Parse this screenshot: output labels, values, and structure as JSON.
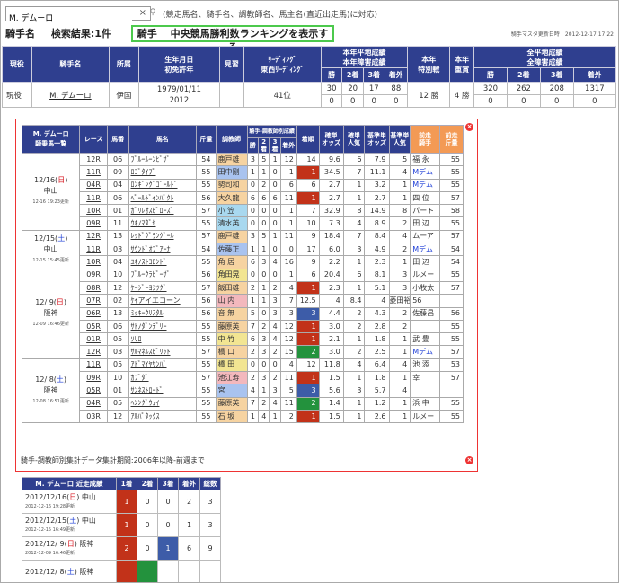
{
  "search": {
    "value": "M. デムーロ",
    "hint": "(競走馬名、騎手名、調教師名、馬主名(直近出走馬)に対応)"
  },
  "header": {
    "label": "騎手名",
    "result": "検索結果:1件",
    "ranking_button": "騎手　 中央競馬勝利数ランキングを表示する",
    "mask_date": "騎手マスタ更新日時　2012-12-17 17:22"
  },
  "main": {
    "headers": {
      "status": "現役",
      "name": "騎手名",
      "affiliation": "所属",
      "birth1": "生年月日",
      "birth2": "初免許年",
      "apprentice": "見習",
      "leading1": "ﾘｰﾃﾞｨﾝｸﾞ",
      "leading2": "東西ﾘｰﾃﾞｨﾝｸﾞ",
      "flat1": "本年平地成績",
      "flat2": "本年障害成績",
      "special1": "本年",
      "special2": "特別戦",
      "graded1": "本年",
      "graded2": "重賞",
      "total1": "全平地成績",
      "total2": "全障害成績",
      "win": "勝",
      "second": "2着",
      "third": "3着",
      "other": "着外"
    },
    "row": {
      "status": "現役",
      "name": "M. デムーロ",
      "affiliation": "伊国",
      "birth": "1979/01/11",
      "license": "2012",
      "apprentice": "",
      "leading": "41位",
      "flat": [
        "30",
        "20",
        "17",
        "88"
      ],
      "hurdle": [
        "0",
        "0",
        "0",
        "0"
      ],
      "special": "12 勝",
      "graded": "4 勝",
      "total_flat": [
        "320",
        "262",
        "208",
        "1317"
      ],
      "total_hurdle": [
        "0",
        "0",
        "0",
        "0"
      ]
    }
  },
  "popup": {
    "title1": "M. デムーロ",
    "title2": "騎乗馬一覧",
    "headers": {
      "race": "レース",
      "num": "馬番",
      "horse": "馬名",
      "weight": "斤量",
      "trainer": "調教師",
      "tstats": "騎手-調教師別成績",
      "w": "勝",
      "s2": "2着",
      "s3": "3着",
      "out": "着外",
      "finish": "着順",
      "odds": "確単\nオッズ",
      "pop": "確単\n人気",
      "bodds": "基準単\nオッズ",
      "bpop": "基準単\n人気",
      "prev_jockey": "前走\n騎手",
      "prev_weight": "前走\n斤量"
    },
    "dates": [
      {
        "d": "12/16(",
        "dw": "日",
        "e": ")",
        "venue": "中山",
        "upd": "12-16 19:23更新",
        "dcol": "red"
      },
      {
        "d": "12/15(",
        "dw": "土",
        "e": ")",
        "venue": "中山",
        "upd": "12-15 15:45更新",
        "dcol": "blue"
      },
      {
        "d": "12/ 9(",
        "dw": "日",
        "e": ")",
        "venue": "阪神",
        "upd": "12-09 16:46更新",
        "dcol": "red"
      },
      {
        "d": "12/ 8(",
        "dw": "土",
        "e": ")",
        "venue": "阪神",
        "upd": "12-08 16:51更新",
        "dcol": "blue"
      }
    ],
    "rows": [
      [
        "12R",
        "06",
        "ﾌﾞﾙｰﾙｰﾝﾋﾞｻﾞ",
        "54",
        "鹿戸雄",
        "3",
        "5",
        "1",
        "12",
        "14",
        "9.6",
        "6",
        "7.9",
        "5",
        "福 永",
        "55"
      ],
      [
        "11R",
        "09",
        "ﾛｺﾞﾀｲﾌﾟ",
        "55",
        "田中剛",
        "1",
        "1",
        "0",
        "1",
        "1",
        "34.5",
        "7",
        "11.1",
        "4",
        "Mデム",
        "55"
      ],
      [
        "04R",
        "04",
        "ﾛﾝｷﾞﾝｸﾞｺﾞｰﾙﾄﾞ",
        "55",
        "勢司和",
        "0",
        "2",
        "0",
        "6",
        "6",
        "2.7",
        "1",
        "3.2",
        "1",
        "Mデム",
        "55"
      ],
      [
        "11R",
        "06",
        "ﾍﾟｰﾙﾄﾞｲﾝﾊﾟｸﾄ",
        "56",
        "大久龍",
        "6",
        "6",
        "6",
        "11",
        "1",
        "2.7",
        "1",
        "2.7",
        "1",
        "四 位",
        "57"
      ],
      [
        "10R",
        "01",
        "ｶﾞﾘﾚｵｽﾋﾟﾛｰｽﾞ",
        "57",
        "小 笠",
        "0",
        "0",
        "0",
        "1",
        "7",
        "32.9",
        "8",
        "14.9",
        "8",
        "パート",
        "58"
      ],
      [
        "09R",
        "11",
        "ｳｷﾉﾏﾀﾞｾ",
        "55",
        "清水英",
        "0",
        "0",
        "0",
        "1",
        "10",
        "7.3",
        "4",
        "8.9",
        "2",
        "田 辺",
        "55"
      ],
      [
        "12R",
        "13",
        "ﾚｯﾄﾞｸﾞﾗﾝｸﾞｰﾙ",
        "57",
        "鹿戸雄",
        "3",
        "5",
        "1",
        "11",
        "9",
        "18.4",
        "7",
        "8.4",
        "4",
        "ムーア",
        "57"
      ],
      [
        "11R",
        "03",
        "ｻｳﾝﾄﾞｵﾌﾞｱｰﾅ",
        "54",
        "佐藤正",
        "1",
        "1",
        "0",
        "0",
        "17",
        "6.0",
        "3",
        "4.9",
        "2",
        "Mデム",
        "54"
      ],
      [
        "10R",
        "04",
        "ﾕｷﾉｽﾄｺﾛﾝﾄﾞ",
        "55",
        "角 居",
        "6",
        "3",
        "4",
        "16",
        "9",
        "2.2",
        "1",
        "2.3",
        "1",
        "田 辺",
        "54"
      ],
      [
        "09R",
        "10",
        "ﾌﾞﾙｰｸﾗﾋﾞｰｻﾞ",
        "56",
        "角田晃",
        "0",
        "0",
        "0",
        "1",
        "6",
        "20.4",
        "6",
        "8.1",
        "3",
        "ルメー",
        "55"
      ],
      [
        "08R",
        "12",
        "ｹｰｼﾞｰﾖｼﾂｸﾞ",
        "57",
        "飯田雄",
        "2",
        "1",
        "2",
        "4",
        "1",
        "2.3",
        "1",
        "5.1",
        "3",
        "小牧太",
        "57"
      ],
      [
        "07R",
        "02",
        "ｹｲアイエコーン",
        "56",
        "山 内",
        "1",
        "1",
        "3",
        "7",
        "12.5",
        "4",
        "8.4",
        "4",
        "菱田裕",
        "56"
      ],
      [
        "06R",
        "13",
        "ﾐｯｷｰｸﾘｽﾀﾙ",
        "56",
        "音 無",
        "5",
        "0",
        "3",
        "3",
        "3",
        "4.4",
        "2",
        "4.3",
        "2",
        "佐藤昌",
        "56"
      ],
      [
        "05R",
        "06",
        "ｻﾄﾉﾀﾞﾝﾃﾞﾘｰ",
        "55",
        "藤原英",
        "7",
        "2",
        "4",
        "12",
        "1",
        "3.0",
        "2",
        "2.8",
        "2",
        "",
        "55"
      ],
      [
        "01R",
        "05",
        "ｿﾘﾛ",
        "55",
        "中 竹",
        "6",
        "3",
        "4",
        "12",
        "1",
        "2.1",
        "1",
        "1.8",
        "1",
        "武 豊",
        "55"
      ],
      [
        "12R",
        "03",
        "ｻﾙﾏﾈﾙｽﾋﾟﾘｯﾄ",
        "57",
        "橋 口",
        "2",
        "3",
        "2",
        "15",
        "2",
        "3.0",
        "2",
        "2.5",
        "1",
        "Mデム",
        "57"
      ],
      [
        "11R",
        "05",
        "ｱﾄﾞﾏｲﾔｻﾝﾊﾞ",
        "55",
        "橋 田",
        "0",
        "0",
        "0",
        "4",
        "12",
        "11.8",
        "4",
        "6.4",
        "4",
        "池 添",
        "53"
      ],
      [
        "09R",
        "10",
        "ｶﾌﾞﾀﾞ",
        "57",
        "池江寿",
        "2",
        "3",
        "2",
        "11",
        "1",
        "1.5",
        "1",
        "1.8",
        "1",
        "幸",
        "57"
      ],
      [
        "05R",
        "01",
        "ｻﾝﾈｽﾄﾛｰﾄﾞ",
        "55",
        "宮",
        "4",
        "1",
        "3",
        "5",
        "3",
        "5.6",
        "3",
        "5.7",
        "4",
        "",
        ""
      ],
      [
        "04R",
        "05",
        "ﾍﾝﾝｸﾞｳｪｲ",
        "55",
        "藤原英",
        "7",
        "2",
        "4",
        "11",
        "2",
        "1.4",
        "1",
        "1.2",
        "1",
        "浜 中",
        "55"
      ],
      [
        "03R",
        "12",
        "ｱﾙﾊﾟﾀｯｸｽ",
        "55",
        "石 坂",
        "1",
        "4",
        "1",
        "2",
        "1",
        "1.5",
        "1",
        "2.6",
        "1",
        "ルメー",
        "55"
      ]
    ],
    "note": "騎手-調教師別集計データ集計期間:2006年以降-前週まで"
  },
  "recent": {
    "headers": {
      "title": "M. デムーロ 近走成績",
      "w": "1着",
      "s2": "2着",
      "s3": "3着",
      "out": "着外",
      "total": "総数"
    },
    "rows": [
      {
        "d": "2012/12/16(",
        "dw": "日",
        "e": ") 中山",
        "upd": "2012-12-16 19:28更新",
        "v": [
          "1",
          "0",
          "0",
          "2",
          "3"
        ],
        "dcol": "red"
      },
      {
        "d": "2012/12/15(",
        "dw": "土",
        "e": ") 中山",
        "upd": "2012-12-15 16:49更新",
        "v": [
          "1",
          "0",
          "0",
          "1",
          "3"
        ],
        "dcol": "blue"
      },
      {
        "d": "2012/12/ 9(",
        "dw": "日",
        "e": ") 阪神",
        "upd": "2012-12-09 16:46更新",
        "v": [
          "2",
          "0",
          "1",
          "6",
          "9"
        ],
        "dcol": "red"
      },
      {
        "d": "2012/12/ 8(",
        "dw": "土",
        "e": ") 阪神",
        "upd": "",
        "v": [
          "",
          "",
          "",
          "",
          ""
        ],
        "dcol": "blue"
      }
    ]
  }
}
